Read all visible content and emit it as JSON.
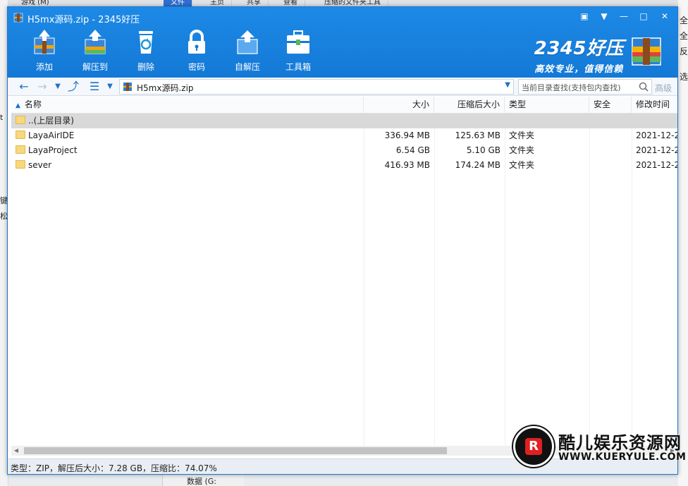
{
  "background": {
    "tabs": [
      "文件",
      "主页",
      "共享",
      "查看",
      "压缩的文件夹工具"
    ],
    "left_fragments": [
      "t",
      "键",
      "松"
    ],
    "right_fragments": [
      "全",
      "全",
      "反",
      "选"
    ],
    "top_left_text": "游戏 (M)",
    "bottom_text": "数据 (G:"
  },
  "window": {
    "title": "H5mx源码.zip - 2345好压",
    "controls": {
      "feedback": "▣",
      "menu": "▼",
      "minimize": "—",
      "maximize": "□",
      "close": "✕"
    }
  },
  "toolbar": [
    {
      "label": "添加",
      "icon": "add-archive-icon"
    },
    {
      "label": "解压到",
      "icon": "extract-to-icon"
    },
    {
      "label": "删除",
      "icon": "recycle-bin-icon"
    },
    {
      "label": "密码",
      "icon": "lock-icon"
    },
    {
      "label": "自解压",
      "icon": "self-extract-icon"
    },
    {
      "label": "工具箱",
      "icon": "toolbox-icon"
    }
  ],
  "brand": {
    "name": "2345好压",
    "slogan": "高效专业，值得信赖"
  },
  "nav": {
    "path": "H5mx源码.zip",
    "search_placeholder": "当前目录查找(支持包内查找)",
    "advanced": "高级"
  },
  "columns": [
    "名称",
    "大小",
    "压缩后大小",
    "类型",
    "安全",
    "修改时间"
  ],
  "rows": [
    {
      "name": "..(上层目录)",
      "size": "",
      "packed": "",
      "type": "",
      "security": "",
      "modified": ""
    },
    {
      "name": "LayaAirIDE",
      "size": "336.94 MB",
      "packed": "125.63 MB",
      "type": "文件夹",
      "security": "",
      "modified": "2021-12-2"
    },
    {
      "name": "LayaProject",
      "size": "6.54 GB",
      "packed": "5.10 GB",
      "type": "文件夹",
      "security": "",
      "modified": "2021-12-2"
    },
    {
      "name": "sever",
      "size": "416.93 MB",
      "packed": "174.24 MB",
      "type": "文件夹",
      "security": "",
      "modified": "2021-12-2"
    }
  ],
  "status": "类型：ZIP，解压后大小：7.28 GB，压缩比：74.07%",
  "watermark": {
    "title": "酷儿娱乐资源网",
    "url": "WWW.KUERYULE.COM",
    "logo_letter": "R"
  },
  "colors": {
    "titlebar": "#1479d6",
    "accent": "#1b72c9",
    "selected_row": "#d9d9d9"
  }
}
